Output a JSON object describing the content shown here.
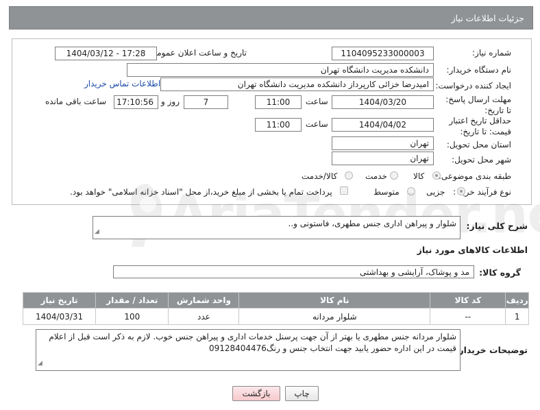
{
  "header": {
    "title": "جزئیات اطلاعات نیاز"
  },
  "form": {
    "need_number_label": "شماره نیاز:",
    "need_number": "1104095233000003",
    "announce_label": "تاریخ و ساعت اعلان عمومی:",
    "announce_value": "1404/03/12 - 17:28",
    "buyer_org_label": "نام دستگاه خریدار:",
    "buyer_org": "دانشکده مدیریت دانشگاه تهران",
    "creator_label": "ایجاد کننده درخواست:",
    "creator": "امیدرضا خزائی کارپرداز دانشکده مدیریت دانشگاه تهران",
    "contact_link": "اطلاعات تماس خریدار",
    "deadline_label": "مهلت ارسال پاسخ: تا تاریخ:",
    "deadline_date": "1404/03/20",
    "time_label": "ساعت",
    "deadline_time": "11:00",
    "days_value": "7",
    "days_label": "روز و",
    "remaining_time": "17:10:56",
    "remaining_label": "ساعت باقی مانده",
    "price_valid_label": "حداقل تاریخ اعتبار قیمت: تا تاریخ:",
    "price_valid_date": "1404/04/02",
    "price_valid_time": "11:00",
    "province_label": "استان محل تحویل:",
    "province": "تهران",
    "city_label": "شهر محل تحویل:",
    "city": "تهران",
    "category_label": "طبقه بندی موضوعی:",
    "category_options": [
      "کالا",
      "خدمت",
      "کالا/خدمت"
    ],
    "process_label": "نوع فرآیند خرید :",
    "process_options": [
      "جزیی",
      "متوسط"
    ],
    "payment_note": "پرداخت تمام یا بخشی از مبلغ خرید،از محل \"اسناد خزانه اسلامی\" خواهد بود."
  },
  "watermark": {
    "text": "AriaTender.net"
  },
  "description": {
    "label": "شرح کلی نیاز:",
    "value": "شلوار و پیراهن اداری جنس مطهری، فاستونی و.."
  },
  "goods": {
    "section_title": "اطلاعات کالاهای مورد نیاز",
    "group_label": "گروه کالا:",
    "group_value": "مد و پوشاک، آرایشی و بهداشتی",
    "columns": [
      "ردیف",
      "کد کالا",
      "نام کالا",
      "واحد شمارش",
      "تعداد / مقدار",
      "تاریخ نیاز"
    ],
    "rows": [
      {
        "row": "1",
        "code": "--",
        "name": "شلوار مردانه",
        "unit": "عدد",
        "qty": "100",
        "date": "1404/03/31"
      }
    ]
  },
  "buyer_notes": {
    "label": "توضیحات خریدار:",
    "value": "شلوار مردانه جنس مطهری یا بهتر از آن جهت پرسنل خدمات اداری و پیراهن جنس خوب. لازم به ذکر است قبل از اعلام قیمت در این اداره حضور یابید جهت انتخاب جنس و رنگ09128404476"
  },
  "buttons": {
    "print": "چاپ",
    "back": "بازگشت"
  }
}
